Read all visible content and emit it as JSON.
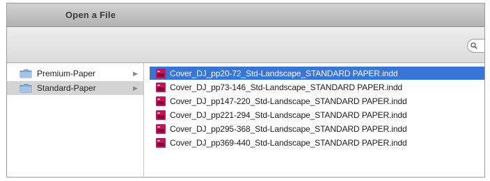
{
  "window": {
    "title": "Open a File"
  },
  "search": {
    "placeholder": ""
  },
  "folders": [
    {
      "label": "Premium-Paper",
      "selected": false
    },
    {
      "label": "Standard-Paper",
      "selected": true
    }
  ],
  "files": [
    {
      "label": "Cover_DJ_pp20-72_Std-Landscape_STANDARD PAPER.indd",
      "selected": true
    },
    {
      "label": "Cover_DJ_pp73-146_Std-Landscape_STANDARD PAPER.indd",
      "selected": false
    },
    {
      "label": "Cover_DJ_pp147-220_Std-Landscape_STANDARD PAPER.indd",
      "selected": false
    },
    {
      "label": "Cover_DJ_pp221-294_Std-Landscape_STANDARD PAPER.indd",
      "selected": false
    },
    {
      "label": "Cover_DJ_pp295-368_Std-Landscape_STANDARD PAPER.indd",
      "selected": false
    },
    {
      "label": "Cover_DJ_pp369-440_Std-Landscape_STANDARD PAPER.indd",
      "selected": false
    }
  ],
  "colors": {
    "selection": "#3875d7",
    "folder_icon": "#7fa9d4",
    "indd_icon": "#c4145a"
  },
  "icons": {
    "folder": "folder-icon",
    "file": "indd-file-icon",
    "search": "search-icon",
    "disclosure": "chevron-right-icon"
  }
}
